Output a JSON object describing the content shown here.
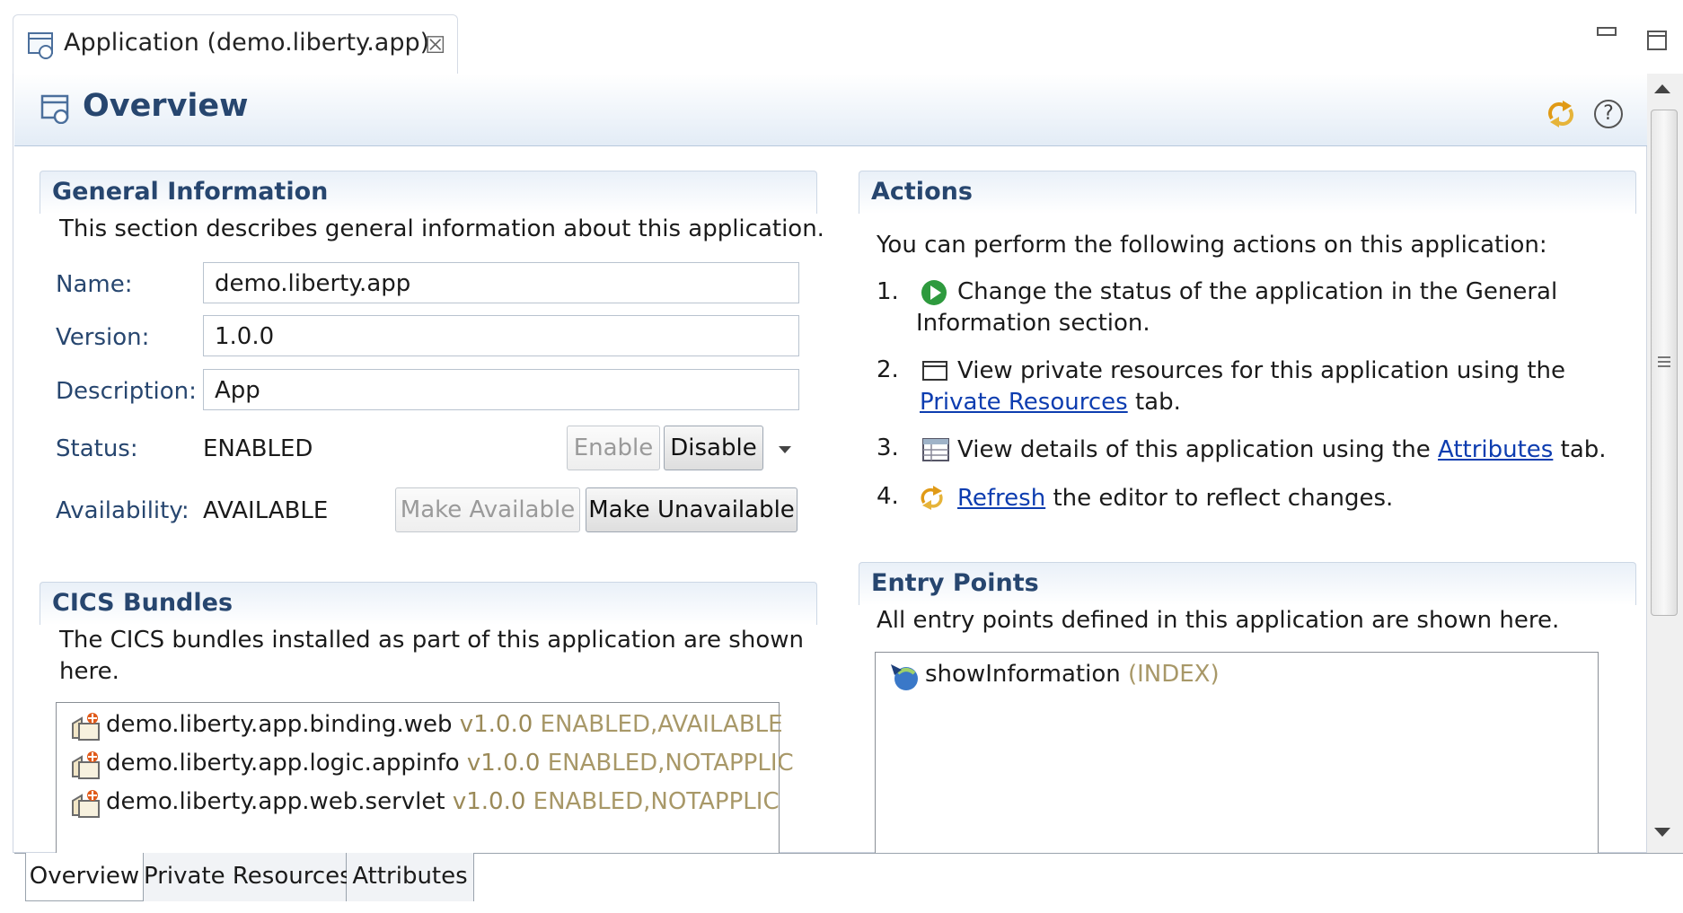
{
  "editor_tab": {
    "title": "Application (demo.liberty.app)",
    "close_glyph": "☒"
  },
  "page": {
    "title": "Overview"
  },
  "general": {
    "title": "General Information",
    "description": "This section describes general information about this application.",
    "name_label": "Name:",
    "name_value": "demo.liberty.app",
    "version_label": "Version:",
    "version_value": "1.0.0",
    "description_label": "Description:",
    "description_value": "App",
    "status_label": "Status:",
    "status_value": "ENABLED",
    "enable_button": "Enable",
    "disable_button": "Disable",
    "availability_label": "Availability:",
    "availability_value": "AVAILABLE",
    "make_available_button": "Make Available",
    "make_unavailable_button": "Make Unavailable"
  },
  "bundles": {
    "title": "CICS Bundles",
    "description_line1": "The CICS bundles installed as part of this application are shown",
    "description_line2": "here.",
    "items": [
      {
        "name": "demo.liberty.app.binding.web",
        "version": "v1.0.0",
        "state": "ENABLED,AVAILABLE"
      },
      {
        "name": "demo.liberty.app.logic.appinfo",
        "version": "v1.0.0",
        "state": "ENABLED,NOTAPPLIC"
      },
      {
        "name": "demo.liberty.app.web.servlet",
        "version": "v1.0.0",
        "state": "ENABLED,NOTAPPLIC"
      }
    ]
  },
  "actions": {
    "title": "Actions",
    "intro": "You can perform the following actions on this application:",
    "item1_num": "1.",
    "item1_line1": "Change the status of the application in the General",
    "item1_line2": "Information section.",
    "item2_num": "2.",
    "item2_line1": "View private resources for this application using the",
    "item2_link": "Private Resources",
    "item2_after": " tab.",
    "item3_num": "3.",
    "item3_before": "View details of this application using the ",
    "item3_link": "Attributes",
    "item3_after": " tab.",
    "item4_num": "4.",
    "item4_link": "Refresh",
    "item4_after": " the editor to reflect changes."
  },
  "entry_points": {
    "title": "Entry Points",
    "description": "All entry points defined in this application are shown here.",
    "items": [
      {
        "name": "showInformation",
        "type": "(INDEX)"
      }
    ]
  },
  "bottom_tabs": [
    "Overview",
    "Private Resources",
    "Attributes"
  ],
  "colors": {
    "section_title": "#27466f",
    "link": "#0d3db0",
    "muted": "#9b8a58"
  },
  "icons": [
    "application-icon",
    "refresh-icon",
    "help-icon",
    "bundle-icon",
    "entry-point-icon",
    "status-change-icon",
    "private-resources-icon",
    "attributes-icon"
  ]
}
